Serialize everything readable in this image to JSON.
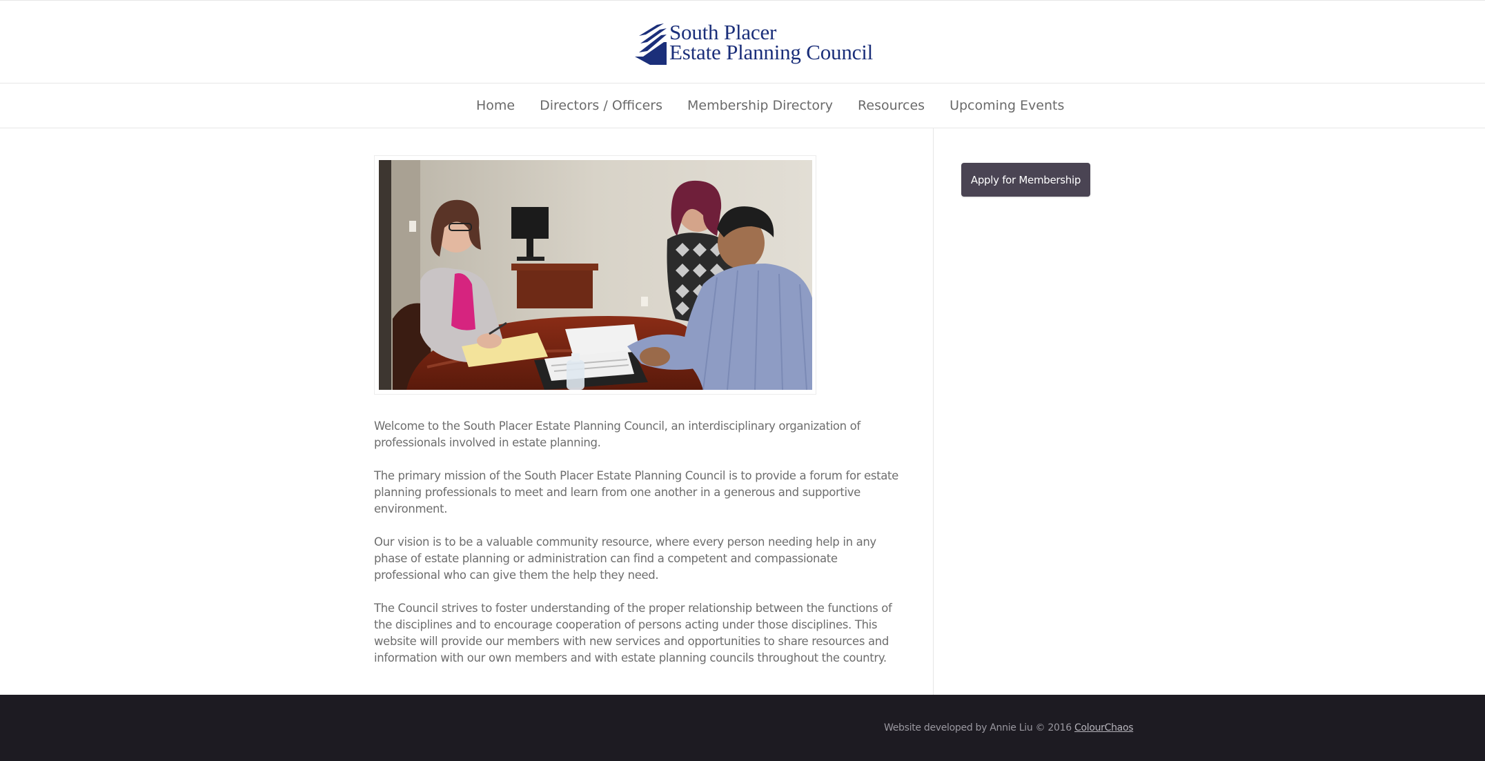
{
  "logo": {
    "line1": "South Placer",
    "line2": "Estate Planning Council",
    "color": "#1b2f7a"
  },
  "nav": {
    "items": [
      {
        "label": "Home"
      },
      {
        "label": "Directors / Officers"
      },
      {
        "label": "Membership Directory"
      },
      {
        "label": "Resources"
      },
      {
        "label": "Upcoming Events"
      }
    ]
  },
  "main": {
    "paragraphs": [
      "Welcome to the South Placer Estate Planning Council, an interdisciplinary organization of professionals involved in estate planning.",
      "The primary mission of the South Placer Estate Planning Council is to provide a forum for estate planning professionals to meet and learn from one another in a generous and supportive environment.",
      "Our vision is to be a valuable community resource, where every person needing help in any phase of estate planning or administration can find a competent and compassionate professional who can give them the help they need.",
      "The Council strives to foster understanding of the proper relationship between the functions of the disciplines and to encourage cooperation of persons acting under those disciplines. This website will provide our members with new services and opportunities to share resources and information with our own members and with estate planning councils throughout the country."
    ]
  },
  "sidebar": {
    "apply_label": "Apply for Membership",
    "button_color": "#4a4453"
  },
  "footer": {
    "text": "Website developed by Annie Liu © 2016",
    "link_label": "ColourChaos",
    "background": "#1d1b22"
  }
}
